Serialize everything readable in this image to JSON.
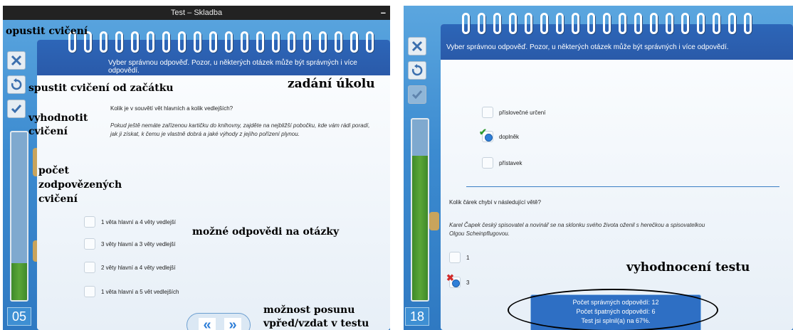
{
  "left": {
    "window_title": "Test – Skladba",
    "minimize_label": "–",
    "counter": "05",
    "progress_fraction": 0.22,
    "instruction": "Vyber správnou odpověď. Pozor, u některých otázek může být správných i více odpovědí.",
    "question": "Kolik je v souvětí vět hlavních a kolik vedlejších?",
    "sentence_line1": "Pokud ještě nemáte zařízenou kartičku do knihovny, zajděte na nejbližší pobočku, kde vám rádi poradí,",
    "sentence_line2": "jak ji získat, k čemu je vlastně dobrá a jaké výhody z jejího pořízení plynou.",
    "options": [
      "1 věta hlavní a 4 věty vedlejší",
      "3 věty hlavní a 3 věty vedlejší",
      "2 věty hlavní a 4 věty vedlejší",
      "1 věta hlavní a 5 vět vedlejších"
    ],
    "nav": {
      "prev": "«",
      "next": "»"
    }
  },
  "right": {
    "counter": "18",
    "progress_fraction": 0.8,
    "instruction": "Vyber správnou odpověď. Pozor, u některých otázek může být správných i více odpovědí.",
    "q1_options": [
      "příslovečné určení",
      "doplněk",
      "přístavek"
    ],
    "q2_question": "Kolik čárek chybí v následující větě?",
    "q2_sentence_line1": "Karel Čapek český spisovatel a novinář se na sklonku svého života oženil s herečkou a spisovatelkou",
    "q2_sentence_line2": "Olgou Scheinpflugovou.",
    "q2_options": [
      "1",
      "3"
    ],
    "results": {
      "correct": "Počet správných odpovědí: 12",
      "wrong": "Počet špatných odpovědí: 6",
      "score": "Test jsi splnil(a) na 67%."
    }
  },
  "annotations": {
    "leave": "opustit cvičení",
    "restart": "spustit cvičení od začátku",
    "task": "zadání úkolu",
    "evaluate_1": "vyhodnotit",
    "evaluate_2": "cvičení",
    "count_1": "počet",
    "count_2": "zodpovězených",
    "count_3": "cvičení",
    "answers": "možné odpovědi na otázky",
    "move_1": "možnost posunu",
    "move_2": "vpřed/vzdat v testu",
    "result": "vyhodnocení testu"
  },
  "colors": {
    "accent_blue": "#2f7fd8",
    "progress_green": "#4b9a30",
    "card_header": "#2a5aa9"
  },
  "icons": {
    "close": "close-icon",
    "restart": "restart-icon",
    "evaluate": "check-icon"
  }
}
